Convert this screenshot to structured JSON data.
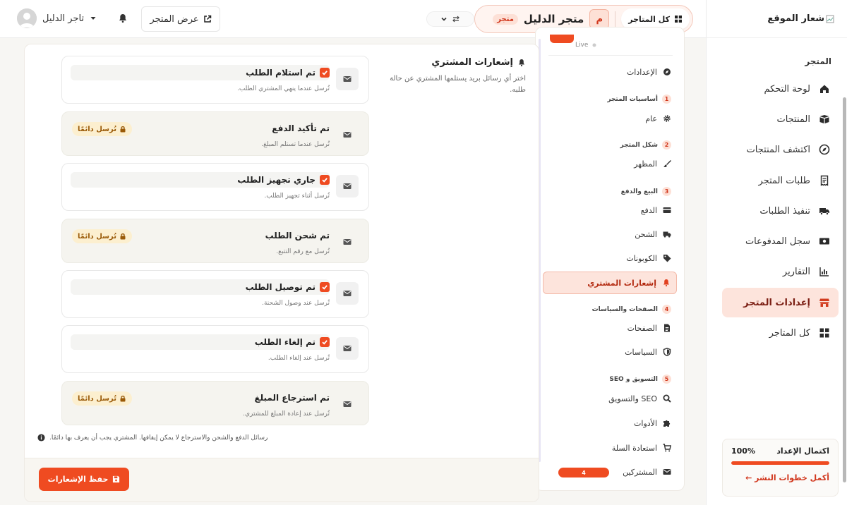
{
  "sidebar": {
    "logo_text": "شعار الموقع",
    "section_title": "المتجر",
    "items": [
      {
        "label": "لوحة التحكم",
        "icon": "home-icon"
      },
      {
        "label": "المنتجات",
        "icon": "box-icon"
      },
      {
        "label": "اكتشف المنتجات",
        "icon": "compass-icon"
      },
      {
        "label": "طلبات المتجر",
        "icon": "receipt-icon"
      },
      {
        "label": "تنفيذ الطلبات",
        "icon": "truck-icon"
      },
      {
        "label": "سجل المدفوعات",
        "icon": "money-icon"
      },
      {
        "label": "التقارير",
        "icon": "chart-icon"
      },
      {
        "label": "إعدادات المتجر",
        "icon": "store-icon",
        "active": true
      },
      {
        "label": "كل المتاجر",
        "icon": "grid-icon"
      }
    ],
    "setup": {
      "title": "اكتمال الإعداد",
      "percent_label": "100%",
      "progress": 1.0,
      "link": "أكمل خطوات النشر ←"
    }
  },
  "topbar": {
    "all_stores_label": "كل المتاجر",
    "store_initial": "م",
    "store_name": "متجر الدليل",
    "store_badge": "متجر",
    "view_store_label": "عرض المتجر",
    "user_name": "تاجر الدليل"
  },
  "subnav": {
    "live_label": "Live",
    "items": {
      "settings": "الإعدادات",
      "general": "عام",
      "appearance": "المظهر",
      "payment": "الدفع",
      "shipping": "الشحن",
      "coupons": "الكوبونات",
      "notifications": "إشعارات المشتري",
      "pages": "الصفحات",
      "policies": "السياسات",
      "seo": "SEO والتسويق",
      "tools": "الأدوات",
      "cart_recovery": "استعادة السلة",
      "subscribers": "المشتركين"
    },
    "groups": [
      {
        "num": "1",
        "label": "أساسيات المتجر"
      },
      {
        "num": "2",
        "label": "شكل المتجر"
      },
      {
        "num": "3",
        "label": "البيع والدفع"
      },
      {
        "num": "4",
        "label": "الصفحات والسياسات"
      },
      {
        "num": "5",
        "label": "التسويق و SEO"
      }
    ],
    "subscribers_count": "4"
  },
  "main": {
    "title": "إشعارات المشتري",
    "description": "اختر أي رسائل بريد يستلمها المشتري عن حالة طلبه.",
    "locked_label": "تُرسل دائمًا",
    "notifications": [
      {
        "title": "تم استلام الطلب",
        "desc": "تُرسل عندما ينهي المشتري الطلب.",
        "locked": false,
        "checked": true
      },
      {
        "title": "تم تأكيد الدفع",
        "desc": "تُرسل عندما تستلم المبلغ.",
        "locked": true,
        "checked": true
      },
      {
        "title": "جاري تجهيز الطلب",
        "desc": "تُرسل أثناء تجهيز الطلب.",
        "locked": false,
        "checked": true
      },
      {
        "title": "تم شحن الطلب",
        "desc": "تُرسل مع رقم التتبع.",
        "locked": true,
        "checked": true
      },
      {
        "title": "تم توصيل الطلب",
        "desc": "تُرسل عند وصول الشحنة.",
        "locked": false,
        "checked": true
      },
      {
        "title": "تم إلغاء الطلب",
        "desc": "تُرسل عند إلغاء الطلب.",
        "locked": false,
        "checked": true
      },
      {
        "title": "تم استرجاع المبلغ",
        "desc": "تُرسل عند إعادة المبلغ للمشتري.",
        "locked": true,
        "checked": true
      }
    ],
    "note": "رسائل الدفع والشحن والاسترجاع لا يمكن إيقافها. المشتري يجب أن يعرف بها دائمًا.",
    "save_label": "حفظ الإشعارات"
  },
  "colors": {
    "accent": "#ef4b21",
    "accent_soft": "#fde4dc",
    "lock_badge_bg": "#fcefcf",
    "lock_badge_text": "#9a5a07"
  }
}
